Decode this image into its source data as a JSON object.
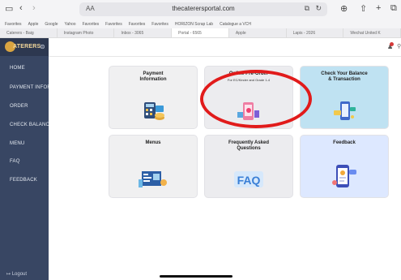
{
  "browser": {
    "address": "thecaterersportal.com",
    "aa_label": "AA",
    "bookmarks": [
      "Favorites",
      "Apple",
      "Google",
      "Yahoo",
      "Favorites",
      "Favorites",
      "Favorites",
      "Favorites",
      "HORIZON Scrap Lab",
      "Catalogue a VCH"
    ],
    "tabs": [
      {
        "label": "Caterers - Baig",
        "active": false
      },
      {
        "label": "Instagram Photo",
        "active": false
      },
      {
        "label": "Inbox - 3065",
        "active": false
      },
      {
        "label": "Portal - 6565",
        "active": true
      },
      {
        "label": "Apple",
        "active": false
      },
      {
        "label": "Lapis - 2026",
        "active": false
      },
      {
        "label": "Wechat United K",
        "active": false
      }
    ]
  },
  "sidebar": {
    "logo_text": "ATERERS",
    "items": [
      "Home",
      "Payment Information",
      "Order",
      "Check Balance",
      "Menu",
      "FAQ",
      "Feedback"
    ],
    "logout": "Logout"
  },
  "cards": [
    {
      "title": "Payment\nInformation",
      "subtitle": ""
    },
    {
      "title": "Online Pre-Order",
      "subtitle": "For EC/Kinder and Grade 1-4"
    },
    {
      "title": "Check Your Balance\n& Transaction",
      "subtitle": ""
    },
    {
      "title": "Menus",
      "subtitle": ""
    },
    {
      "title": "Frequently Asked\nQuestions",
      "subtitle": ""
    },
    {
      "title": "Feedback",
      "subtitle": ""
    }
  ],
  "colors": {
    "sidebar": "#384663",
    "highlight_ring": "#e11b1b",
    "balance_card": "#bfe2f2",
    "feedback_card": "#dde8ff"
  },
  "icons": [
    "sidebar-icon",
    "back-icon",
    "forward-icon",
    "reload-icon",
    "download-icon",
    "share-icon",
    "new-tab-icon",
    "tabs-icon",
    "menu-toggle-icon",
    "notification-bell-icon",
    "user-icon"
  ]
}
